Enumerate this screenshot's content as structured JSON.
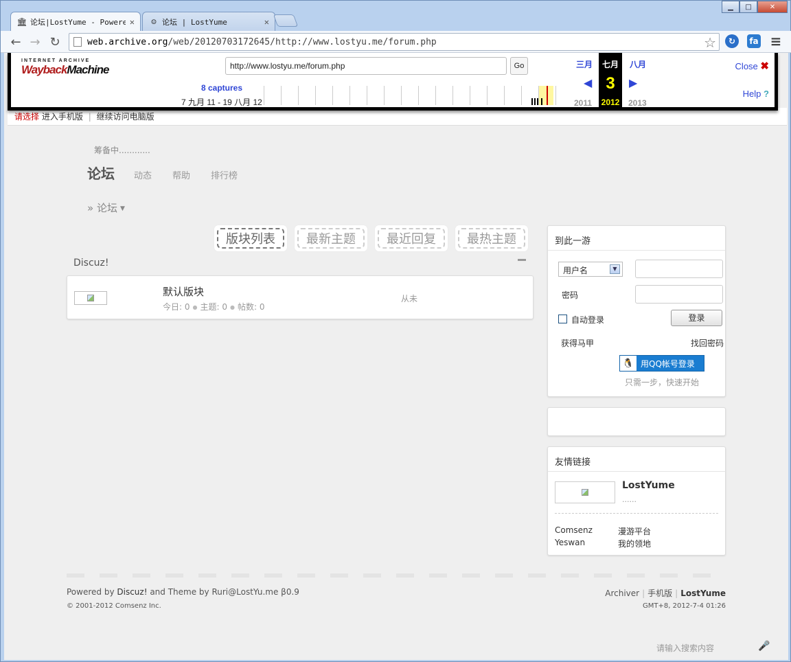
{
  "browser": {
    "tabs": [
      {
        "label": "论坛|LostYume - Powered",
        "icon": "archive-icon"
      },
      {
        "label": "论坛 | LostYume",
        "icon": "avatar-icon"
      }
    ],
    "url_domain": "web.archive.org",
    "url_path": "/web/20120703172645/http://www.lostyu.me/forum.php",
    "ext1": "↻",
    "ext2": "fa",
    "menu_icon": "≡"
  },
  "wayback": {
    "logo_top": "INTERNET ARCHIVE",
    "logo_wb": "Wayback",
    "logo_machine": "Machine",
    "url_value": "http://www.lostyu.me/forum.php",
    "go_label": "Go",
    "captures": "8 captures",
    "range": "7 九月 11 - 19 八月 12",
    "prev_month": "三月",
    "cur_month": "七月",
    "next_month": "八月",
    "cur_day": "3",
    "prev_year": "2011",
    "cur_year": "2012",
    "next_year": "2013",
    "close_label": "Close",
    "help_label": "Help",
    "help_mark": "?",
    "close_mark": "✖",
    "arrow_prev": "◀",
    "arrow_next": "▶"
  },
  "mobile_bar": {
    "prompt": "请选择",
    "mobile": "进入手机版",
    "sep": "|",
    "desktop": "继续访问电脑版"
  },
  "site": {
    "subtitle": "筹备中............",
    "nav_main": "论坛",
    "nav_items": [
      "动态",
      "帮助",
      "排行榜"
    ],
    "breadcrumb": "» 论坛",
    "caret": "▼"
  },
  "view_tabs": [
    "版块列表",
    "最新主题",
    "最近回复",
    "最热主题"
  ],
  "category": {
    "title": "Discuz!",
    "forum_name": "默认版块",
    "stats": {
      "today": "今日: 0",
      "threads": "主题: 0",
      "posts": "帖数: 0"
    },
    "dot": "●",
    "last_post": "从未"
  },
  "login": {
    "title": "到此一游",
    "username_option": "用户名",
    "dropdown_arrow": "▼",
    "password_label": "密码",
    "auto_login": "自动登录",
    "login_button": "登录",
    "register": "获得马甲",
    "forgot": "找回密码",
    "qq_button": "用QQ帐号登录",
    "qq_icon": "🐧",
    "qq_hint": "只需一步，快速开始"
  },
  "links": {
    "title": "友情链接",
    "featured_name": "LostYume",
    "featured_desc": "......",
    "rows": [
      {
        "name": "Comsenz",
        "desc": "漫游平台"
      },
      {
        "name": "Yeswan",
        "desc": "我的领地"
      }
    ]
  },
  "footer": {
    "powered_prefix": "Powered by ",
    "powered_discuz": "Discuz!",
    "powered_suffix": " and  Theme by Ruri@LostYu.me β0.9",
    "copyright": "© 2001-2012 Comsenz Inc.",
    "archiver": "Archiver",
    "mobile": "手机版",
    "site": "LostYume",
    "time": "GMT+8, 2012-7-4 01:26",
    "sep": "|"
  },
  "search": {
    "placeholder": "请输入搜索内容",
    "mic": "🎤"
  }
}
